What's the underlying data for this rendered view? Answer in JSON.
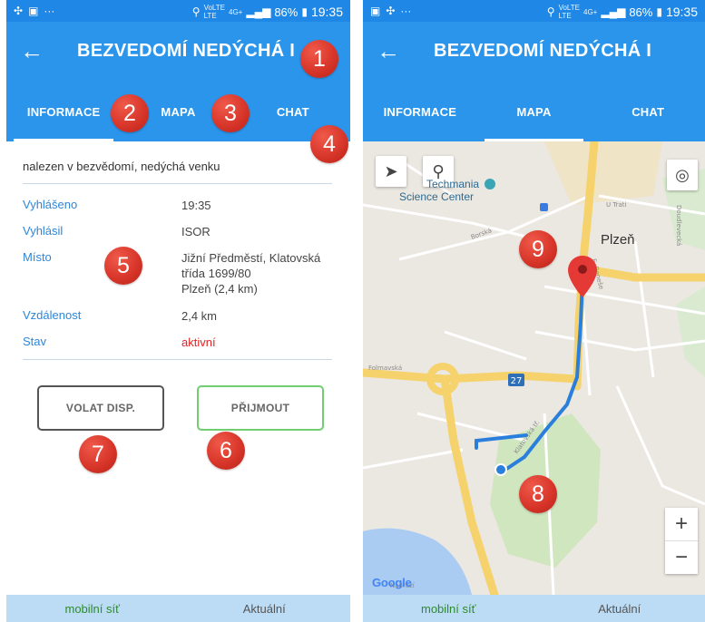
{
  "statusbar": {
    "battery": "86%",
    "time": "19:35",
    "volte_top": "VoLTE",
    "volte_bottom": "LTE",
    "net_top": "4G+",
    "net_bottom": "",
    "left_icons": [
      "settings-icon",
      "image-icon",
      "dots-icon"
    ]
  },
  "appbar": {
    "title": "BEZVEDOMÍ NEDÝCHÁ I"
  },
  "tabs": [
    {
      "label": "INFORMACE"
    },
    {
      "label": "MAPA"
    },
    {
      "label": "CHAT"
    }
  ],
  "info": {
    "summary": "nalezen v bezvědomí, nedýchá venku",
    "rows": [
      {
        "label": "Vyhlášeno",
        "value": "19:35"
      },
      {
        "label": "Vyhlásil",
        "value": "ISOR"
      },
      {
        "label": "Místo",
        "value_lines": [
          "Jižní Předměstí, Klatovská",
          "třída 1699/80",
          "Plzeň (2,4 km)"
        ]
      },
      {
        "label": "Vzdálenost",
        "value": "2,4 km"
      },
      {
        "label": "Stav",
        "value": "aktivní"
      }
    ],
    "call_button": "VOLAT DISP.",
    "accept_button": "PŘIJMOUT"
  },
  "bottombar": {
    "network": "mobilní síť",
    "status": "Aktuální"
  },
  "badges": [
    "1",
    "2",
    "3",
    "4",
    "5",
    "6",
    "7",
    "8",
    "9"
  ],
  "map": {
    "poi_name_1": "Techmania",
    "poi_name_2": "Science Center",
    "city": "Plzeň",
    "road_number": "27",
    "logo": "Google",
    "zoom_in": "+",
    "zoom_out": "−",
    "street_labels": [
      "Borská",
      "U Trati",
      "E. Beneše",
      "Folmavská",
      "Klatovská tř.",
      "Doudlevecká",
      "Nádraží"
    ]
  },
  "colors": {
    "primary": "#2b95ec",
    "statusbar": "#1f88e6",
    "label_blue": "#2f86d6",
    "status_red": "#e02525",
    "accept_green": "#6fce6f",
    "badge_red": "#d8362a",
    "route_blue": "#2a7fdc",
    "bottombar": "#bcdcf5"
  }
}
